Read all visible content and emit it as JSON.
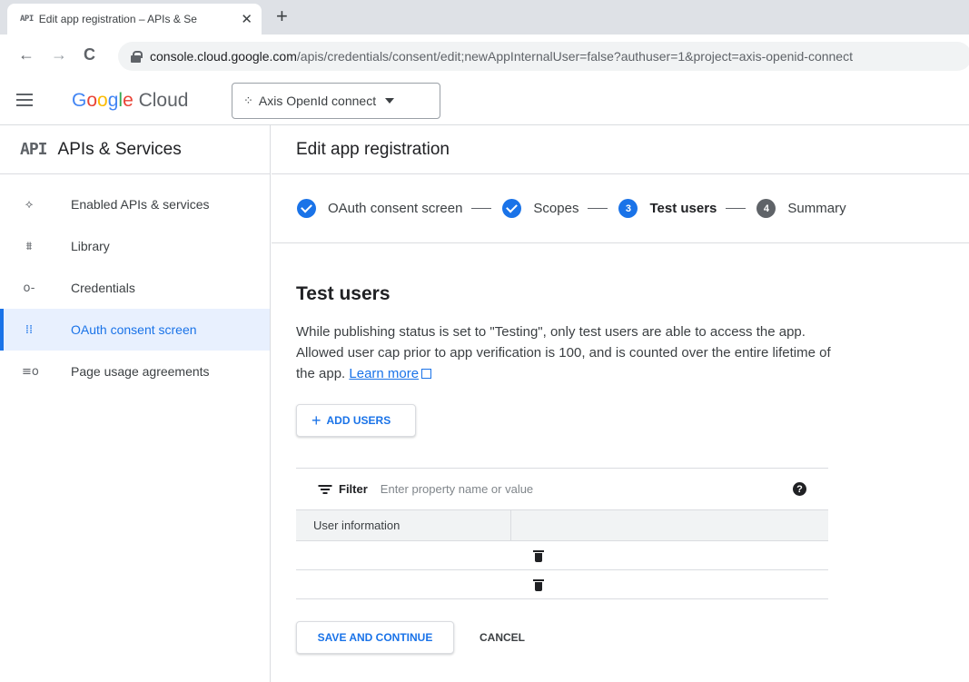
{
  "browser": {
    "tab_favicon": "API",
    "tab_title": "Edit app registration – APIs & Se",
    "tab_close": "✕",
    "new_tab": "+",
    "back": "←",
    "forward": "→",
    "reload": "C",
    "url_host": "console.cloud.google.com",
    "url_path": "/apis/credentials/consent/edit;newAppInternalUser=false?authuser=1&project=axis-openid-connect"
  },
  "header": {
    "logo_letters": [
      "G",
      "o",
      "o",
      "g",
      "l",
      "e"
    ],
    "logo_suffix": " Cloud",
    "project_name": "Axis OpenId connect"
  },
  "sidebar": {
    "badge": "API",
    "title": "APIs & Services",
    "items": [
      {
        "icon": "⟡",
        "label": "Enabled APIs & services",
        "active": false
      },
      {
        "icon": "⩩",
        "label": "Library",
        "active": false
      },
      {
        "icon": "o-",
        "label": "Credentials",
        "active": false
      },
      {
        "icon": "⁞⁞",
        "label": "OAuth consent screen",
        "active": true
      },
      {
        "icon": "≡o",
        "label": "Page usage agreements",
        "active": false
      }
    ]
  },
  "main": {
    "page_title": "Edit app registration",
    "steps": [
      {
        "label": "OAuth consent screen",
        "state": "done"
      },
      {
        "label": "Scopes",
        "state": "done"
      },
      {
        "number": "3",
        "label": "Test users",
        "state": "current"
      },
      {
        "number": "4",
        "label": "Summary",
        "state": "pending"
      }
    ],
    "section_title": "Test users",
    "description": "While publishing status is set to \"Testing\", only test users are able to access the app. Allowed user cap prior to app verification is 100, and is counted over the entire lifetime of the app. ",
    "learn_more": "Learn more",
    "add_users_label": "ADD USERS",
    "filter_label": "Filter",
    "filter_placeholder": "Enter property name or value",
    "help_icon": "?",
    "table_header": "User information",
    "row_count": 2,
    "save_label": "SAVE AND CONTINUE",
    "cancel_label": "CANCEL"
  },
  "colors": {
    "accent": "#1a73e8",
    "active_bg": "#e8f0fe",
    "pending_step": "#5f6368"
  }
}
